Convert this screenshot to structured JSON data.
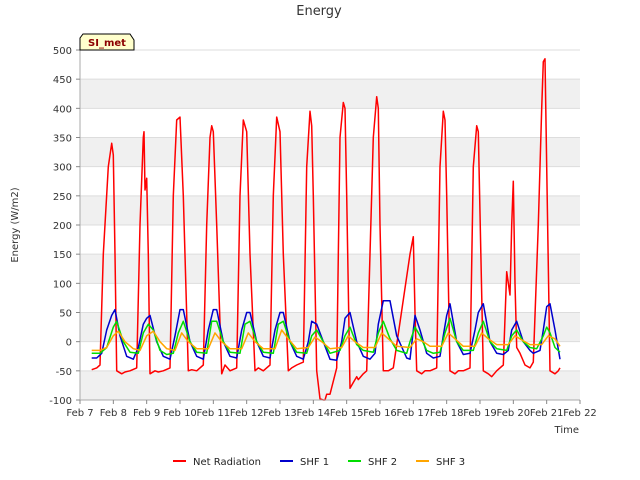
{
  "chart_data": {
    "type": "line",
    "title": "Energy",
    "xlabel": "Time",
    "ylabel": "Energy (W/m2)",
    "site_tag": "SI_met",
    "ylim": [
      -100,
      500
    ],
    "yticks": [
      -100,
      -50,
      0,
      50,
      100,
      150,
      200,
      250,
      300,
      350,
      400,
      450,
      500
    ],
    "xlim": [
      7,
      22
    ],
    "xticks": [
      7,
      8,
      9,
      10,
      11,
      12,
      13,
      14,
      15,
      16,
      17,
      18,
      19,
      20,
      21,
      22
    ],
    "xtick_labels": [
      "Feb 7",
      "Feb 8",
      "Feb 9",
      "Feb 10",
      "Feb 11",
      "Feb 12",
      "Feb 13",
      "Feb 14",
      "Feb 15",
      "Feb 16",
      "Feb 17",
      "Feb 18",
      "Feb 19",
      "Feb 20",
      "Feb 21",
      "Feb 22"
    ],
    "grid": "horizontal alternating bands",
    "legend_position": "bottom",
    "series": [
      {
        "name": "Net Radiation",
        "color": "#ff0000",
        "x": [
          7.35,
          7.5,
          7.6,
          7.7,
          7.85,
          7.95,
          8.0,
          8.05,
          8.1,
          8.25,
          8.35,
          8.5,
          8.7,
          8.8,
          8.9,
          8.92,
          8.95,
          9.0,
          9.05,
          9.1,
          9.25,
          9.35,
          9.5,
          9.7,
          9.8,
          9.9,
          10.0,
          10.1,
          10.25,
          10.35,
          10.5,
          10.7,
          10.8,
          10.9,
          10.95,
          11.0,
          11.1,
          11.25,
          11.35,
          11.5,
          11.7,
          11.8,
          11.9,
          12.0,
          12.1,
          12.25,
          12.35,
          12.5,
          12.7,
          12.8,
          12.9,
          13.0,
          13.1,
          13.25,
          13.35,
          13.5,
          13.7,
          13.8,
          13.9,
          13.95,
          14.0,
          14.1,
          14.2,
          14.3,
          14.35,
          14.4,
          14.5,
          14.7,
          14.8,
          14.9,
          14.95,
          15.0,
          15.1,
          15.2,
          15.3,
          15.35,
          15.5,
          15.6,
          15.8,
          15.9,
          15.95,
          16.0,
          16.1,
          16.25,
          16.4,
          16.9,
          17.0,
          17.05,
          17.1,
          17.25,
          17.35,
          17.5,
          17.7,
          17.8,
          17.9,
          17.95,
          18.0,
          18.1,
          18.25,
          18.35,
          18.5,
          18.7,
          18.8,
          18.9,
          18.95,
          19.0,
          19.1,
          19.25,
          19.35,
          19.5,
          19.7,
          19.8,
          19.9,
          19.95,
          20.0,
          20.05,
          20.1,
          20.2,
          20.35,
          20.5,
          20.6,
          20.75,
          20.85,
          20.9,
          20.95,
          21.0,
          21.1,
          21.25,
          21.35,
          21.4
        ],
        "y": [
          -48,
          -45,
          -40,
          150,
          300,
          340,
          320,
          150,
          -50,
          -55,
          -52,
          -50,
          -45,
          200,
          350,
          360,
          260,
          280,
          150,
          -55,
          -50,
          -52,
          -50,
          -45,
          250,
          380,
          385,
          250,
          -50,
          -48,
          -50,
          -40,
          200,
          350,
          370,
          360,
          200,
          -55,
          -40,
          -50,
          -45,
          250,
          380,
          360,
          150,
          -50,
          -45,
          -50,
          -40,
          250,
          385,
          360,
          150,
          -50,
          -45,
          -40,
          -35,
          300,
          395,
          370,
          250,
          -50,
          -98,
          -100,
          -100,
          -90,
          -90,
          -45,
          350,
          410,
          400,
          250,
          -80,
          -70,
          -60,
          -65,
          -55,
          -50,
          350,
          420,
          400,
          200,
          -50,
          -50,
          -45,
          150,
          180,
          50,
          -50,
          -55,
          -50,
          -50,
          -45,
          300,
          395,
          380,
          250,
          -50,
          -55,
          -50,
          -50,
          -45,
          300,
          370,
          360,
          220,
          -50,
          -55,
          -60,
          -50,
          -40,
          120,
          80,
          200,
          275,
          100,
          -10,
          -20,
          -40,
          -45,
          -35,
          200,
          400,
          480,
          485,
          300,
          -50,
          -55,
          -50,
          -45
        ]
      },
      {
        "name": "SHF 1",
        "color": "#0000cc",
        "x": [
          7.35,
          7.5,
          7.65,
          7.8,
          7.95,
          8.05,
          8.2,
          8.4,
          8.6,
          8.75,
          8.9,
          9.0,
          9.1,
          9.3,
          9.5,
          9.7,
          9.85,
          10.0,
          10.1,
          10.3,
          10.5,
          10.7,
          10.85,
          11.0,
          11.1,
          11.3,
          11.5,
          11.7,
          11.85,
          12.0,
          12.1,
          12.3,
          12.5,
          12.7,
          12.85,
          13.0,
          13.1,
          13.3,
          13.5,
          13.7,
          13.85,
          13.95,
          14.1,
          14.3,
          14.5,
          14.7,
          14.85,
          14.95,
          15.1,
          15.3,
          15.5,
          15.7,
          15.85,
          15.95,
          16.1,
          16.3,
          16.5,
          16.8,
          16.9,
          17.05,
          17.2,
          17.4,
          17.6,
          17.8,
          17.9,
          18.0,
          18.1,
          18.3,
          18.5,
          18.7,
          18.85,
          18.95,
          19.1,
          19.3,
          19.5,
          19.7,
          19.85,
          19.95,
          20.1,
          20.3,
          20.5,
          20.6,
          20.8,
          20.9,
          21.0,
          21.1,
          21.25,
          21.4
        ],
        "y": [
          -28,
          -28,
          -20,
          20,
          45,
          55,
          10,
          -25,
          -30,
          -10,
          30,
          40,
          45,
          0,
          -25,
          -30,
          10,
          55,
          55,
          0,
          -25,
          -30,
          20,
          55,
          55,
          0,
          -25,
          -28,
          20,
          50,
          50,
          0,
          -25,
          -28,
          20,
          50,
          50,
          0,
          -25,
          -30,
          0,
          35,
          30,
          0,
          -30,
          -32,
          0,
          40,
          50,
          0,
          -25,
          -30,
          -20,
          30,
          70,
          70,
          10,
          -28,
          -30,
          45,
          20,
          -20,
          -28,
          -25,
          10,
          45,
          65,
          0,
          -22,
          -20,
          20,
          50,
          65,
          0,
          -20,
          -22,
          -15,
          20,
          35,
          0,
          -15,
          -20,
          -15,
          20,
          60,
          65,
          20,
          -30
        ]
      },
      {
        "name": "SHF 2",
        "color": "#00dd00",
        "x": [
          7.35,
          7.6,
          7.8,
          8.0,
          8.1,
          8.3,
          8.5,
          8.75,
          8.9,
          9.05,
          9.2,
          9.4,
          9.6,
          9.8,
          9.95,
          10.1,
          10.3,
          10.5,
          10.8,
          10.95,
          11.1,
          11.3,
          11.5,
          11.8,
          11.95,
          12.1,
          12.3,
          12.5,
          12.8,
          12.95,
          13.1,
          13.3,
          13.5,
          13.8,
          13.95,
          14.1,
          14.3,
          14.5,
          14.8,
          14.95,
          15.1,
          15.3,
          15.5,
          15.8,
          15.95,
          16.1,
          16.3,
          16.5,
          16.8,
          16.9,
          17.05,
          17.2,
          17.4,
          17.6,
          17.8,
          17.95,
          18.1,
          18.3,
          18.5,
          18.8,
          18.95,
          19.1,
          19.3,
          19.5,
          19.8,
          19.95,
          20.1,
          20.3,
          20.5,
          20.7,
          20.9,
          21.0,
          21.1,
          21.25,
          21.4
        ],
        "y": [
          -20,
          -20,
          -10,
          25,
          35,
          0,
          -18,
          -20,
          15,
          30,
          20,
          -15,
          -22,
          -20,
          15,
          35,
          0,
          -18,
          -20,
          35,
          35,
          0,
          -18,
          -20,
          30,
          35,
          0,
          -18,
          -20,
          30,
          35,
          0,
          -18,
          -20,
          10,
          20,
          0,
          -20,
          -15,
          10,
          25,
          -5,
          -15,
          -18,
          15,
          35,
          5,
          -15,
          -20,
          0,
          25,
          10,
          -15,
          -20,
          -18,
          15,
          40,
          0,
          -15,
          -15,
          15,
          35,
          0,
          -12,
          -15,
          10,
          20,
          0,
          -10,
          -12,
          10,
          25,
          15,
          -10,
          -18
        ]
      },
      {
        "name": "SHF 3",
        "color": "#ffa500",
        "x": [
          7.35,
          7.6,
          7.8,
          8.0,
          8.15,
          8.35,
          8.6,
          8.8,
          9.0,
          9.2,
          9.4,
          9.6,
          9.85,
          10.05,
          10.25,
          10.5,
          10.85,
          11.05,
          11.25,
          11.5,
          11.85,
          12.05,
          12.25,
          12.5,
          12.85,
          13.05,
          13.25,
          13.5,
          13.85,
          14.05,
          14.25,
          14.5,
          14.85,
          15.05,
          15.25,
          15.5,
          15.85,
          16.05,
          16.25,
          16.5,
          16.9,
          17.1,
          17.3,
          17.5,
          17.85,
          18.05,
          18.25,
          18.5,
          18.85,
          19.05,
          19.25,
          19.5,
          19.85,
          20.05,
          20.25,
          20.5,
          20.85,
          21.05,
          21.25,
          21.4
        ],
        "y": [
          -15,
          -15,
          -10,
          10,
          18,
          0,
          -12,
          -15,
          10,
          18,
          0,
          -12,
          -15,
          15,
          0,
          -12,
          -12,
          15,
          0,
          -12,
          -12,
          15,
          0,
          -12,
          -12,
          20,
          5,
          -12,
          -10,
          8,
          0,
          -12,
          -10,
          10,
          0,
          -10,
          -10,
          15,
          5,
          -8,
          -10,
          5,
          0,
          -8,
          -8,
          15,
          5,
          -8,
          -8,
          15,
          5,
          -5,
          -5,
          10,
          3,
          -5,
          -5,
          10,
          5,
          -8
        ]
      }
    ]
  }
}
